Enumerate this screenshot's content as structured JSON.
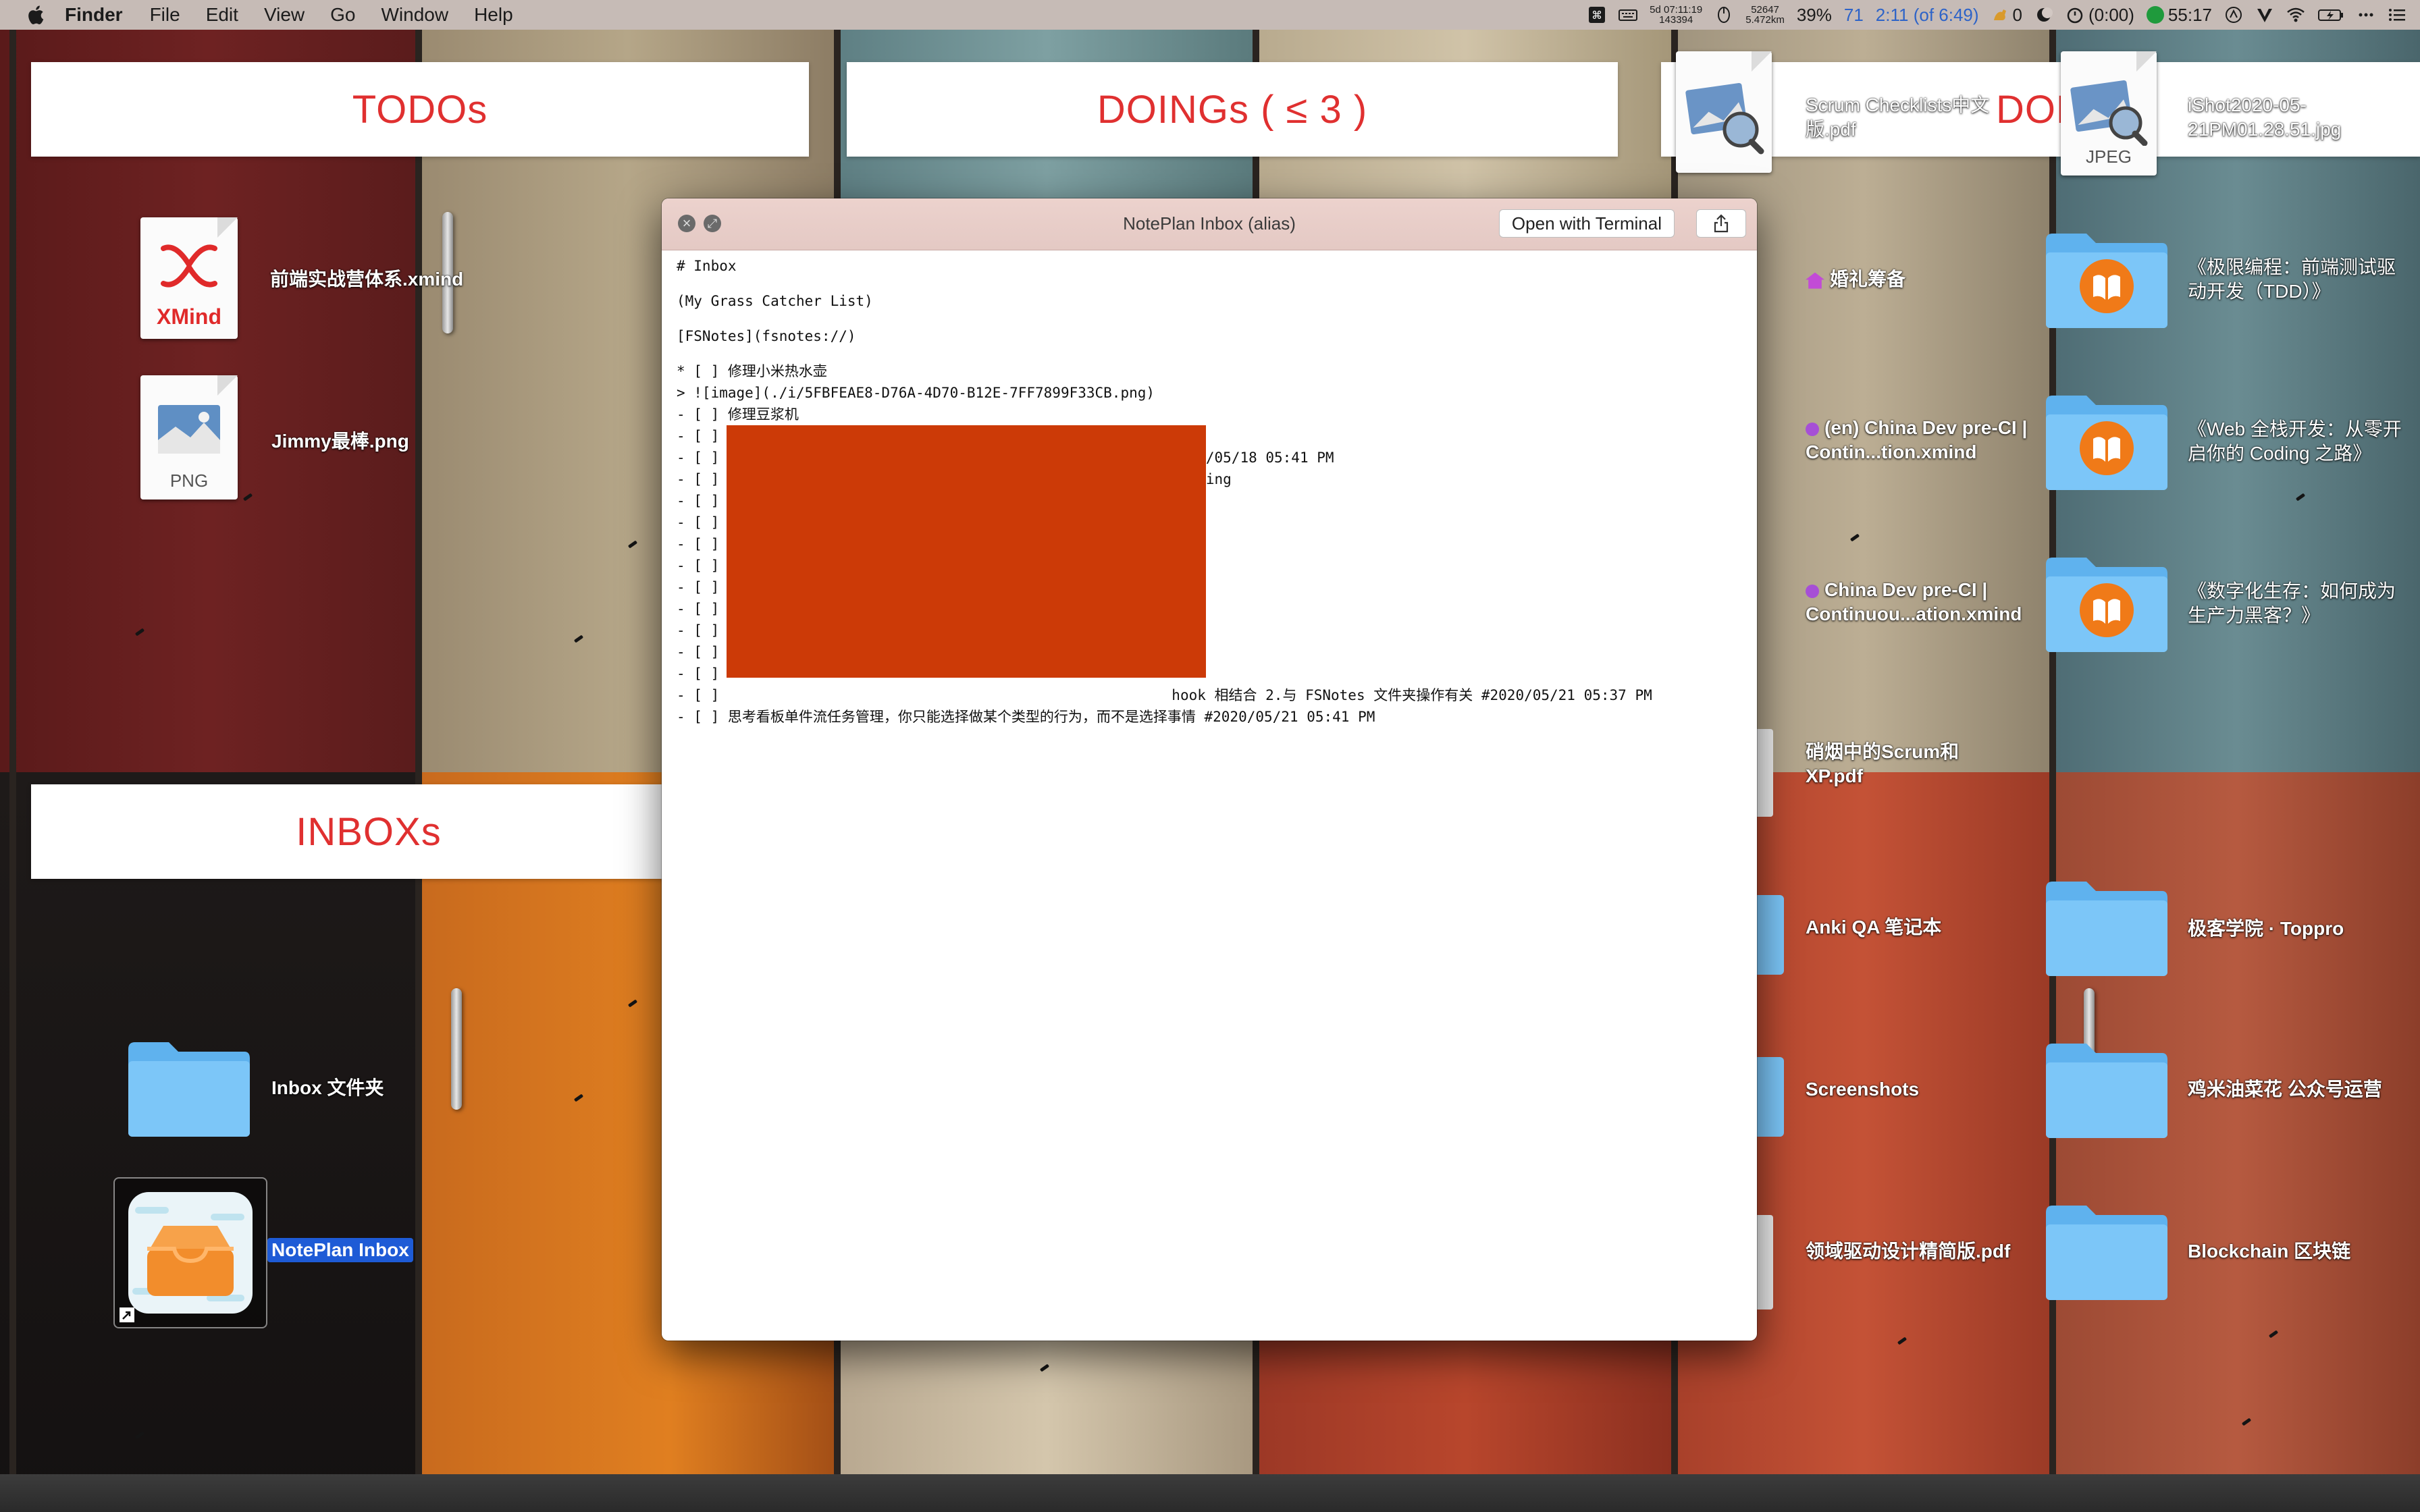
{
  "menubar": {
    "app_name": "Finder",
    "menus": [
      "File",
      "Edit",
      "View",
      "Go",
      "Window",
      "Help"
    ],
    "status": {
      "timer_top": "5d 07:11:19",
      "timer_bottom": "143394",
      "steps_top": "52647",
      "steps_bottom": "5.472km",
      "battery_pct": "39%",
      "count": "71",
      "time_progress": "2:11 (of 6:49)",
      "coins": "0",
      "elapsed": "(0:00)",
      "clock": "55:17"
    }
  },
  "columns": {
    "todos": "TODOs",
    "doings": "DOINGs ( ≤ 3 )",
    "done": "DON",
    "inboxs": "INBOXs"
  },
  "desktop": {
    "todos_items": [
      {
        "label": "前端实战营体系.xmind",
        "icon": "xmind-icon",
        "badge": "XMind"
      },
      {
        "label": "Jimmy最棒.png",
        "icon": "png-file-icon",
        "badge": "PNG"
      }
    ],
    "inbox_items": [
      {
        "label": "Inbox 文件夹",
        "icon": "folder-icon"
      },
      {
        "label": "NotePlan Inbox",
        "icon": "noteplan-inbox-icon"
      }
    ],
    "doings_items": [
      {
        "label": "婚礼筹备"
      },
      {
        "label": "(en) China Dev pre-CI | Contin...tion.xmind"
      },
      {
        "label": "China Dev pre-CI | Continuou...ation.xmind"
      },
      {
        "label": "硝烟中的Scrum和XP.pdf"
      },
      {
        "label": "Anki QA 笔记本"
      },
      {
        "label": "Screenshots"
      },
      {
        "label": "领域驱动设计精简版.pdf"
      }
    ],
    "top_files": [
      {
        "label": "Scrum Checklists中文版.pdf",
        "icon": "preview-pdf-icon"
      },
      {
        "label": "iShot2020-05-21PM01.28.51.jpg",
        "icon": "jpeg-file-icon",
        "badge": "JPEG"
      }
    ],
    "done_items": [
      {
        "label": "《极限编程：前端测试驱动开发（TDD）》"
      },
      {
        "label": "《Web 全栈开发：从零开启你的 Coding 之路》"
      },
      {
        "label": "《数字化生存：如何成为生产力黑客？》"
      },
      {
        "label": "极客学院 · Toppro"
      },
      {
        "label": "鸡米油菜花 公众号运营"
      },
      {
        "label": "Blockchain 区块链"
      }
    ]
  },
  "quicklook": {
    "title": "NotePlan Inbox (alias)",
    "open_button": "Open with Terminal",
    "lines": [
      "# Inbox",
      "",
      "(My Grass Catcher List)",
      "",
      "[FSNotes](fsnotes://)",
      "",
      "* [ ] 修理小米热水壶",
      "> ![image](./i/5FBFEAE8-D76A-4D70-B12E-7FF7899F33CB.png)",
      "- [ ] 修理豆浆机",
      "- [ ]                                                    4",
      "- [ ]                                                    #2020/05/18 05:41 PM",
      "- [ ]                                                    /writing",
      "- [ ]",
      "- [ ]",
      "- [ ]",
      "- [ ]",
      "- [ ]",
      "- [ ]",
      "- [ ]",
      "- [ ]",
      "- [ ]",
      "- [ ]                                                     hook 相结合 2.与 FSNotes 文件夹操作有关 #2020/05/21 05:37 PM",
      "- [ ] 思考看板单件流任务管理，你只能选择做某个类型的行为，而不是选择事情 #2020/05/21 05:41 PM"
    ],
    "redaction_color": "#cc3a07"
  }
}
